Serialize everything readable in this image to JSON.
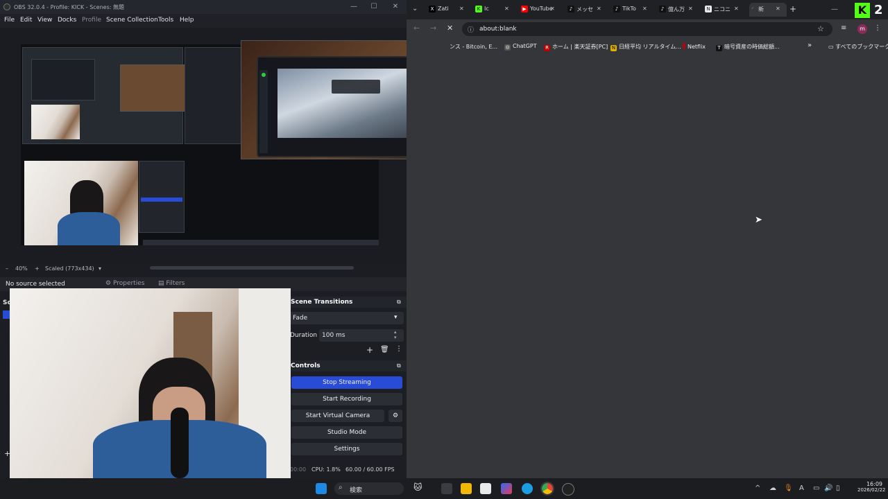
{
  "obs": {
    "title": "OBS 32.0.4 - Profile: KICK - Scenes: 無題",
    "menu": [
      "File",
      "Edit",
      "View",
      "Docks",
      "Profile",
      "Scene Collection",
      "Tools",
      "Help"
    ],
    "zoom_minus": "–",
    "zoom_level": "40%",
    "zoom_plus": "+",
    "scale_mode": "Scaled (773x434)",
    "source_status": "No source selected",
    "properties_label": "Properties",
    "filters_label": "Filters",
    "scenes_dock_fragment": "Sc",
    "add_fragment": "+",
    "transitions": {
      "header": "Scene Transitions",
      "selected_transition": "Fade",
      "duration_label": "Duration",
      "duration_value": "100 ms"
    },
    "controls": {
      "header": "Controls",
      "stop_streaming": "Stop Streaming",
      "start_recording": "Start Recording",
      "start_virtual_camera": "Start Virtual Camera",
      "studio_mode": "Studio Mode",
      "settings": "Settings"
    },
    "status": {
      "time_fragment": "00:00",
      "cpu": "CPU: 1.8%",
      "fps": "60.00 / 60.00 FPS"
    },
    "window_controls": [
      "—",
      "☐",
      "✕"
    ]
  },
  "chrome": {
    "tabs": [
      {
        "label": "Zati",
        "favicon": "X",
        "color": "#000000"
      },
      {
        "label": "Ic",
        "favicon": "K",
        "color": "#53fc18"
      },
      {
        "label": "YouTube",
        "favicon": "▶",
        "color": "#ff0000"
      },
      {
        "label": "メッセ",
        "favicon": "♪",
        "color": "#111111"
      },
      {
        "label": "TikTo",
        "favicon": "♪",
        "color": "#111111"
      },
      {
        "label": "億ん万",
        "favicon": "♪",
        "color": "#111111"
      },
      {
        "label": "ニコニ",
        "favicon": "N",
        "color": "#e8e8e8"
      },
      {
        "label": "新",
        "favicon": "",
        "color": "#35363a"
      }
    ],
    "new_tab": "+",
    "url": "about:blank",
    "bookmarks": [
      {
        "label": "ンス - Bitcoin, E...",
        "favicon": "",
        "color": "#35363a"
      },
      {
        "label": "ChatGPT",
        "favicon": "◎",
        "color": "#444"
      },
      {
        "label": "ホーム | 楽天証券[PC]",
        "favicon": "R",
        "color": "#bf0000"
      },
      {
        "label": "日経平均 リアルタイム...",
        "favicon": "N",
        "color": "#e0b000"
      },
      {
        "label": "Netflix",
        "favicon": "",
        "color": "#b00610"
      },
      {
        "label": "暗号資産の時価総額...",
        "favicon": "T",
        "color": "#111"
      }
    ],
    "more_bookmarks": "»",
    "all_bookmarks": "すべてのブックマーク",
    "window_controls": [
      "—",
      "☐",
      "✕"
    ]
  },
  "overlay_logo": {
    "letter": "K",
    "digit": "2"
  },
  "taskbar": {
    "search_label": "検索",
    "clock_time": "16:09",
    "clock_date": "2026/02/22",
    "ime": "A"
  },
  "colors": {
    "accent_blue": "#284cd6",
    "kick_green": "#53fc18",
    "obs_bg": "#1b1d23",
    "chrome_bg": "#35363a"
  }
}
